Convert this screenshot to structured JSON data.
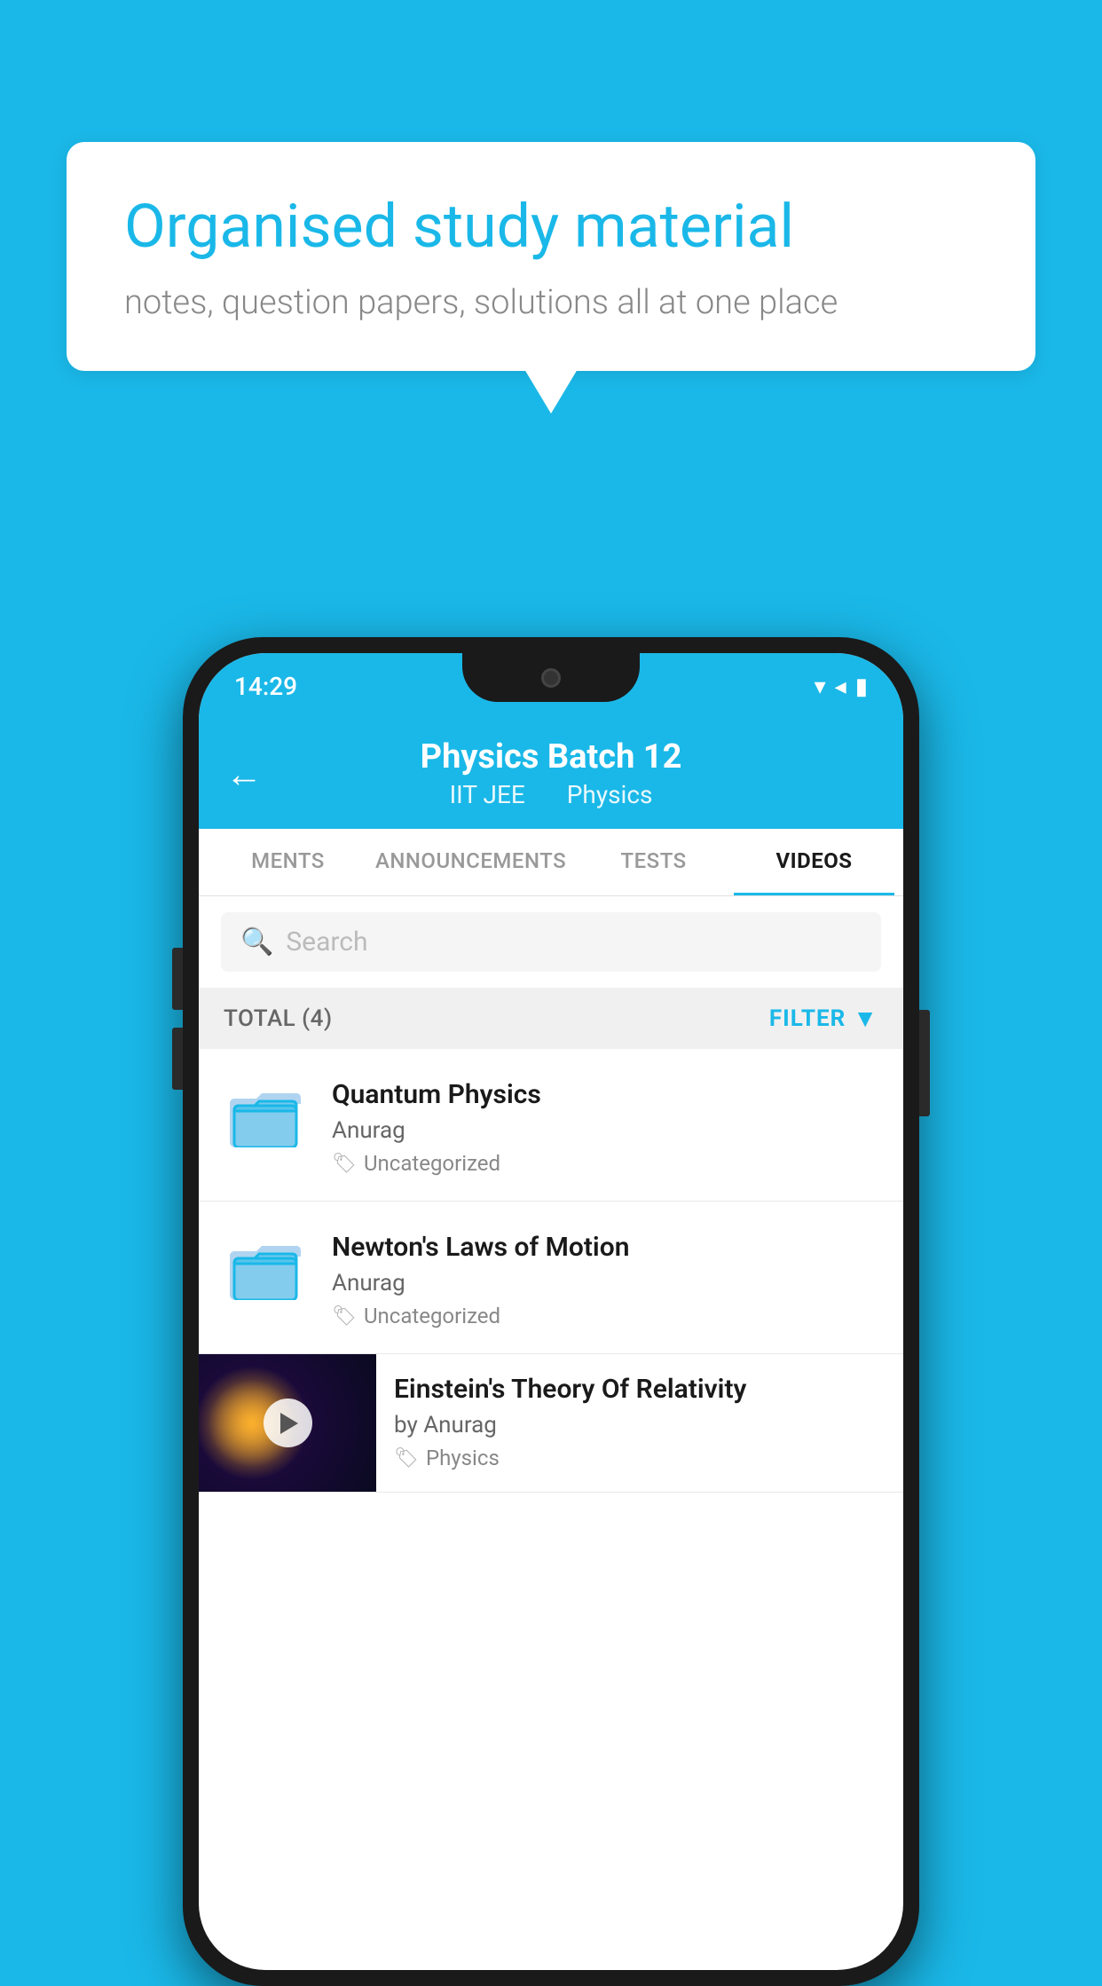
{
  "background_color": "#1ab8e8",
  "speech_bubble": {
    "title": "Organised study material",
    "subtitle": "notes, question papers, solutions all at one place"
  },
  "status_bar": {
    "time": "14:29",
    "wifi": "▼",
    "signal": "◀",
    "battery": "▮"
  },
  "app_header": {
    "title": "Physics Batch 12",
    "subtitle_part1": "IIT JEE",
    "subtitle_part2": "Physics",
    "back_label": "←"
  },
  "tabs": [
    {
      "label": "MENTS",
      "active": false
    },
    {
      "label": "ANNOUNCEMENTS",
      "active": false
    },
    {
      "label": "TESTS",
      "active": false
    },
    {
      "label": "VIDEOS",
      "active": true
    }
  ],
  "search": {
    "placeholder": "Search"
  },
  "filter_bar": {
    "total_label": "TOTAL (4)",
    "filter_label": "FILTER"
  },
  "videos": [
    {
      "id": 1,
      "title": "Quantum Physics",
      "author": "Anurag",
      "tag": "Uncategorized",
      "has_thumb": false
    },
    {
      "id": 2,
      "title": "Newton's Laws of Motion",
      "author": "Anurag",
      "tag": "Uncategorized",
      "has_thumb": false
    },
    {
      "id": 3,
      "title": "Einstein's Theory Of Relativity",
      "author": "by Anurag",
      "tag": "Physics",
      "has_thumb": true
    }
  ]
}
